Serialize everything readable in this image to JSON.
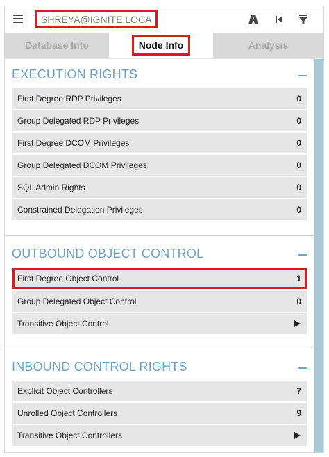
{
  "search": {
    "value": "SHREYA@IGNITE.LOCAL"
  },
  "toolbar": {
    "icons": [
      "pathfinding-icon",
      "back-icon",
      "filter-icon"
    ]
  },
  "tabs": [
    {
      "label": "Database Info",
      "active": false
    },
    {
      "label": "Node Info",
      "active": true
    },
    {
      "label": "Analysis",
      "active": false
    }
  ],
  "sections": [
    {
      "title": "EXECUTION RIGHTS",
      "rows": [
        {
          "label": "First Degree RDP Privileges",
          "value": "0"
        },
        {
          "label": "Group Delegated RDP Privileges",
          "value": "0"
        },
        {
          "label": "First Degree DCOM Privileges",
          "value": "0"
        },
        {
          "label": "Group Delegated DCOM Privileges",
          "value": "0"
        },
        {
          "label": "SQL Admin Rights",
          "value": "0"
        },
        {
          "label": "Constrained Delegation Privileges",
          "value": "0"
        }
      ]
    },
    {
      "title": "OUTBOUND OBJECT CONTROL",
      "rows": [
        {
          "label": "First Degree Object Control",
          "value": "1",
          "highlighted": true
        },
        {
          "label": "Group Delegated Object Control",
          "value": "0"
        },
        {
          "label": "Transitive Object Control",
          "value": ""
        }
      ]
    },
    {
      "title": "INBOUND CONTROL RIGHTS",
      "rows": [
        {
          "label": "Explicit Object Controllers",
          "value": "7"
        },
        {
          "label": "Unrolled Object Controllers",
          "value": "9"
        },
        {
          "label": "Transitive Object Controllers",
          "value": ""
        }
      ]
    }
  ],
  "colors": {
    "accent": "#6ba6c8",
    "highlight": "#e01a1a"
  }
}
